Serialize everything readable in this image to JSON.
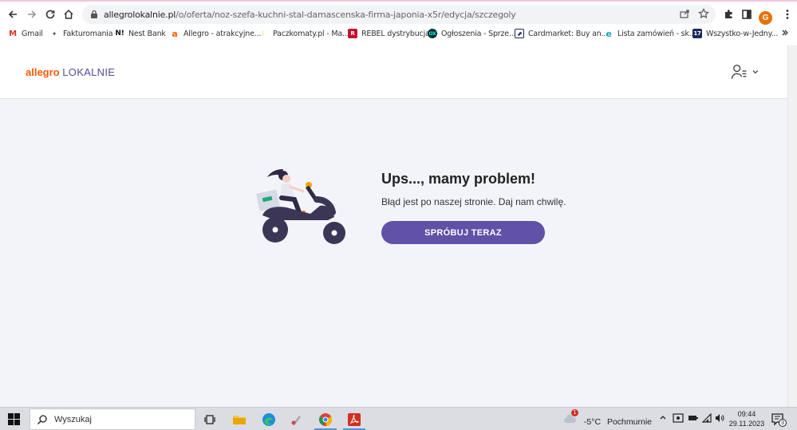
{
  "browser": {
    "url_host": "allegrolokalnie.pl",
    "url_path": "/o/oferta/noz-szefa-kuchni-stal-damascenska-firma-japonia-x5r/edycja/szczegoly",
    "profile_initial": "G",
    "bookmarks": [
      {
        "label": "Gmail"
      },
      {
        "label": "Fakturomania"
      },
      {
        "label": "Nest Bank"
      },
      {
        "label": "Allegro - atrakcyjne..."
      },
      {
        "label": "Paczkomaty.pl - Ma..."
      },
      {
        "label": "REBEL dystrybucja"
      },
      {
        "label": "Ogłoszenia - Sprze..."
      },
      {
        "label": "Cardmarket: Buy an..."
      },
      {
        "label": "Lista zamówień - sk..."
      },
      {
        "label": "Wszystko-w-Jedny..."
      }
    ]
  },
  "site": {
    "logo_part1": "allegro",
    "logo_part2": "LOKALNIE"
  },
  "error": {
    "title": "Ups..., mamy problem!",
    "message": "Błąd jest po naszej stronie. Daj nam chwilę.",
    "retry_label": "SPRÓBUJ TERAZ"
  },
  "taskbar": {
    "search_placeholder": "Wyszukaj",
    "weather_temp": "-5°C",
    "weather_desc": "Pochmurnie",
    "weather_badge": "1",
    "time": "09:44",
    "date": "29.11.2023",
    "notification_count": "3"
  },
  "colors": {
    "accent": "#6151a7",
    "allegro_orange": "#ff5a00",
    "page_bg": "#f3f4f9"
  }
}
